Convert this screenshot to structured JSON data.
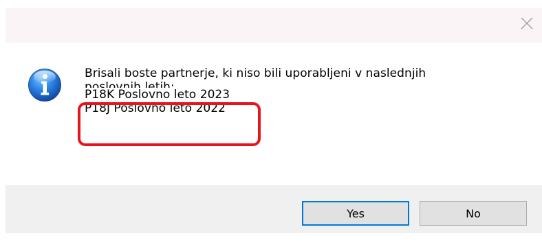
{
  "dialog": {
    "message_lines": [
      "Brisali boste partnerje, ki niso bili uporabljeni v naslednjih",
      "poslovnih letih:",
      "P18K Poslovno leto 2023",
      "P18J Poslovno leto 2022"
    ],
    "icon": "info-icon",
    "highlight_color": "#e8141c"
  },
  "buttons": {
    "yes_label": "Yes",
    "no_label": "No"
  },
  "titlebar": {
    "close_icon": "close-icon"
  }
}
